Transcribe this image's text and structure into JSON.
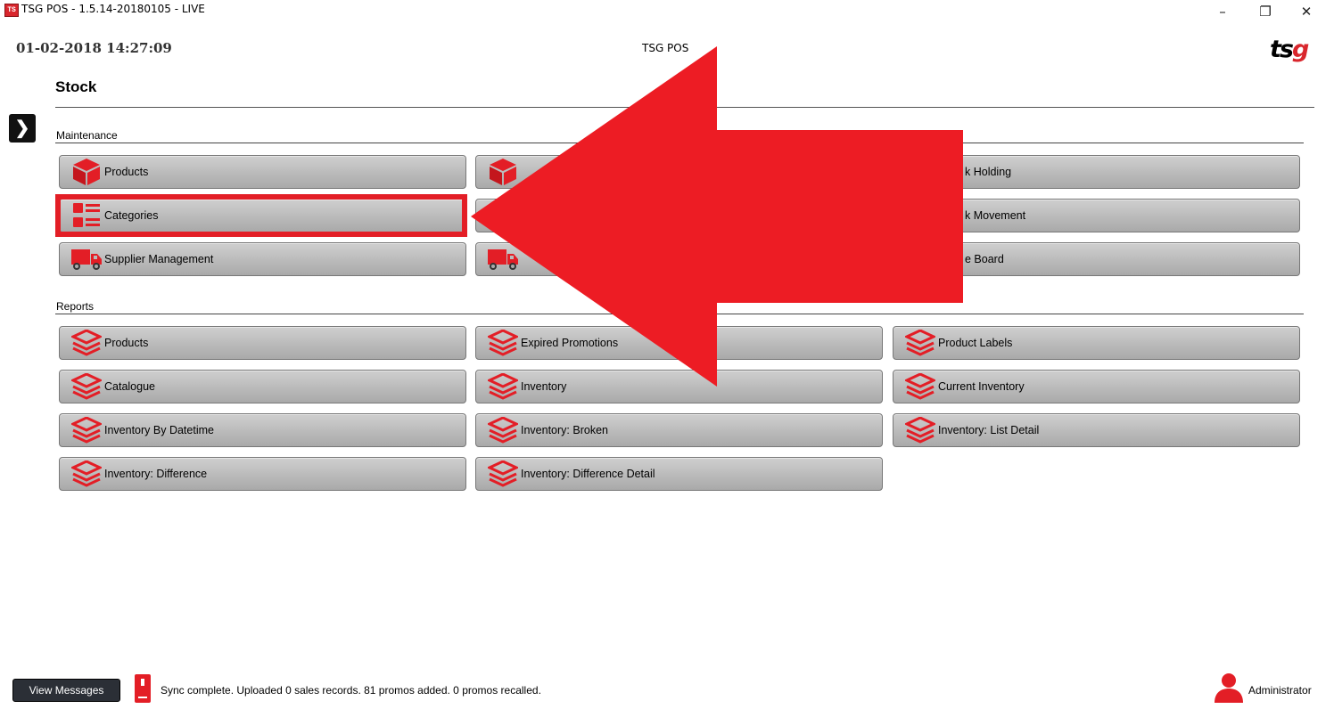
{
  "window": {
    "title": "TSG POS - 1.5.14-20180105 - LIVE",
    "app_icon_text": "TS",
    "minimize": "–",
    "restore": "❐",
    "close": "✕"
  },
  "header": {
    "datetime": "01-02-2018 14:27:09",
    "center_title": "TSG POS",
    "logo_ts": "ts",
    "logo_g": "g"
  },
  "page": {
    "title": "Stock",
    "sidebar_toggle": "❯"
  },
  "sections": {
    "maintenance": {
      "label": "Maintenance",
      "tiles": [
        {
          "label": "Products",
          "icon": "box-icon"
        },
        {
          "label": "",
          "icon": "box-icon"
        },
        {
          "label": "k Holding",
          "icon": ""
        },
        {
          "label": "Categories",
          "icon": "list-icon"
        },
        {
          "label": "",
          "icon": ""
        },
        {
          "label": "k Movement",
          "icon": ""
        },
        {
          "label": "Supplier Management",
          "icon": "truck-icon"
        },
        {
          "label": "",
          "icon": "truck-icon"
        },
        {
          "label": "e Board",
          "icon": ""
        }
      ]
    },
    "reports": {
      "label": "Reports",
      "tiles": [
        {
          "label": "Products",
          "icon": "layers-icon"
        },
        {
          "label": "Expired Promotions",
          "icon": "layers-icon"
        },
        {
          "label": "Product Labels",
          "icon": "layers-icon"
        },
        {
          "label": "Catalogue",
          "icon": "layers-icon"
        },
        {
          "label": "Inventory",
          "icon": "layers-icon"
        },
        {
          "label": "Current Inventory",
          "icon": "layers-icon"
        },
        {
          "label": "Inventory By Datetime",
          "icon": "layers-icon"
        },
        {
          "label": "Inventory: Broken",
          "icon": "layers-icon"
        },
        {
          "label": "Inventory: List Detail",
          "icon": "layers-icon"
        },
        {
          "label": "Inventory: Difference",
          "icon": "layers-icon"
        },
        {
          "label": "Inventory: Difference Detail",
          "icon": "layers-icon"
        }
      ]
    }
  },
  "footer": {
    "view_messages": "View Messages",
    "status": "Sync complete.  Uploaded 0 sales records. 81 promos added. 0 promos recalled.",
    "user": "Administrator"
  },
  "colors": {
    "accent": "#d9262d",
    "annotation_red": "#ed1c24"
  }
}
